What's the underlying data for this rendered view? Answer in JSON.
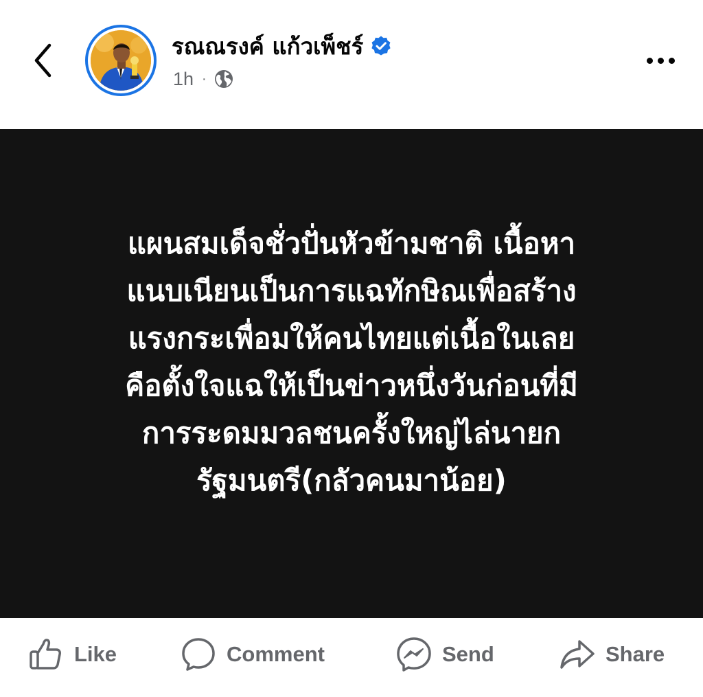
{
  "header": {
    "back_icon": "chevron-left-icon",
    "author_name": "รณณรงค์ แก้วเพ็ชร์",
    "verified_icon": "verified-badge-icon",
    "time_ago": "1h",
    "separator": "·",
    "audience_icon": "globe-icon",
    "more_icon": "more-horizontal-icon"
  },
  "post": {
    "lines": [
      "แผนสมเด็จชั่วปั่นหัวข้ามชาติ เนื้อหา",
      "แนบเนียนเป็นการแฉทักษิณเพื่อสร้าง",
      "แรงกระเพื่อมให้คนไทยแต่เนื้อในเลย",
      "คือตั้งใจแฉให้เป็นข่าวหนึ่งวันก่อนที่มี",
      "การระดมมวลชนครั้งใหญ่ไล่นายก",
      "รัฐมนตรี(กลัวคนมาน้อย)"
    ],
    "background_color": "#131313",
    "text_color": "#ffffff"
  },
  "actions": {
    "like_label": "Like",
    "comment_label": "Comment",
    "send_label": "Send",
    "share_label": "Share"
  },
  "colors": {
    "accent": "#1b74e4",
    "secondary_text": "#65676b",
    "primary_text": "#050505"
  }
}
